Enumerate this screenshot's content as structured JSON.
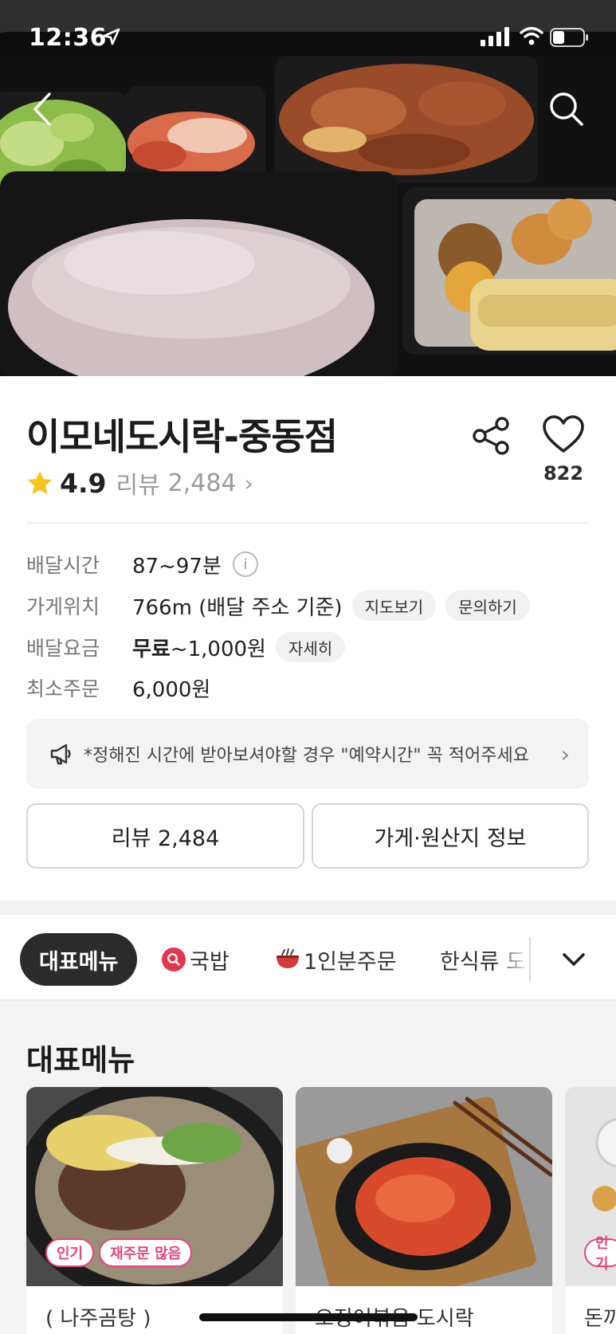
{
  "status_bar": {
    "time": "12:36"
  },
  "hero": {
    "image": "dosirak-lunchbox-photo",
    "back_icon": "back-arrow-icon",
    "search_icon": "search-icon"
  },
  "store": {
    "name": "이모네도시락-중동점",
    "rating": "4.9",
    "review_label": "리뷰",
    "review_count": "2,484",
    "like_count": "822"
  },
  "info": {
    "delivery_time": {
      "label": "배달시간",
      "value": "87~97분"
    },
    "location": {
      "label": "가게위치",
      "value": "766m (배달 주소 기준)",
      "chip_map": "지도보기",
      "chip_ask": "문의하기"
    },
    "fee": {
      "label": "배달요금",
      "value_bold": "무료",
      "value_rest": "~1,000원",
      "chip_detail": "자세히"
    },
    "min_order": {
      "label": "최소주문",
      "value": "6,000원"
    }
  },
  "notice": {
    "text": "*정해진 시간에 받아보셔야할 경우 \"예약시간\" 꼭 적어주세요"
  },
  "buttons": {
    "review": "리뷰 2,484",
    "store_info": "가게·원산지 정보"
  },
  "tabs": [
    {
      "label": "대표메뉴",
      "active": true
    },
    {
      "label": "국밥",
      "icon": "search-badge-icon"
    },
    {
      "label": "1인분주문",
      "icon": "bowl-icon"
    },
    {
      "label": "한식류 도"
    }
  ],
  "menu": {
    "section_title": "대표메뉴",
    "cards": [
      {
        "name": "( 나주곰탕 )",
        "badges": [
          "인기",
          "재주문 많음"
        ]
      },
      {
        "name": "오징어볶음 도시락",
        "badges": []
      },
      {
        "name": "돈까",
        "badges": [
          "인기"
        ]
      }
    ]
  },
  "colors": {
    "accent_pink": "#e6457a",
    "star": "#f5c518",
    "active_tab": "#2b2b2b"
  }
}
